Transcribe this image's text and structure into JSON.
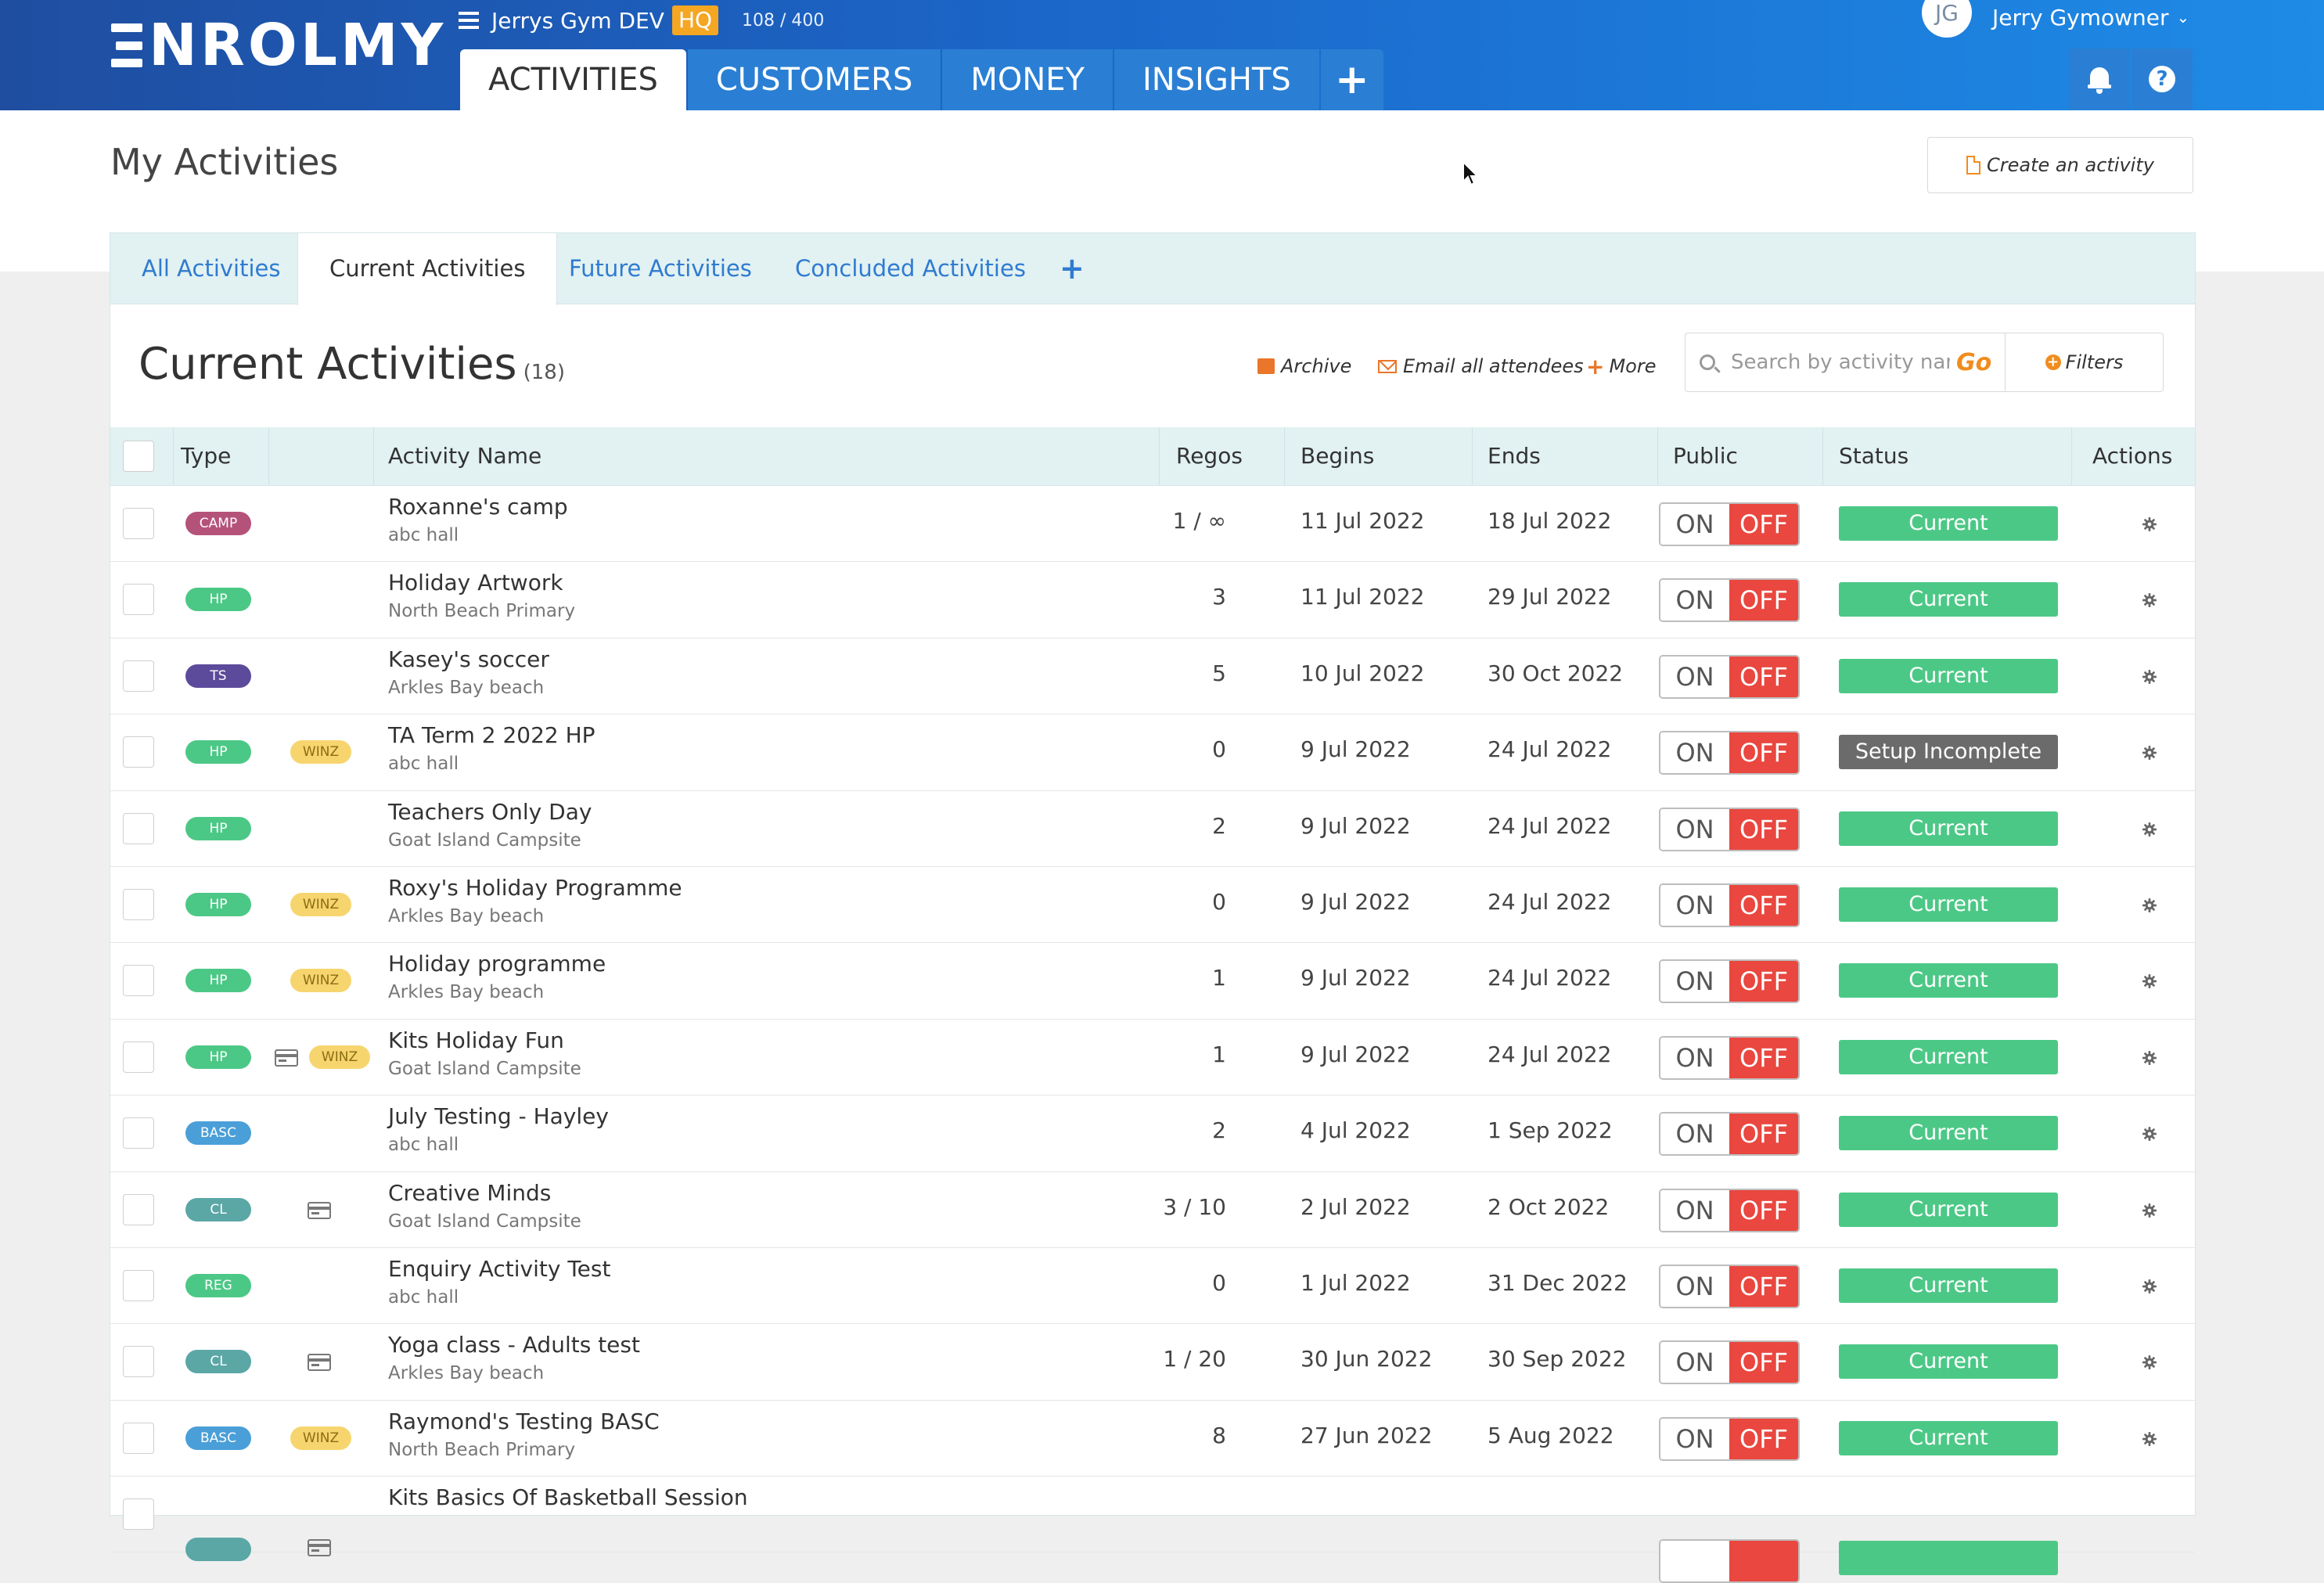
{
  "header": {
    "logo": "NROLMY",
    "account_name": "Jerrys Gym DEV",
    "account_badge": "HQ",
    "usage": "108 / 400",
    "nav": [
      {
        "label": "ACTIVITIES",
        "active": true
      },
      {
        "label": "CUSTOMERS",
        "active": false
      },
      {
        "label": "MONEY",
        "active": false
      },
      {
        "label": "INSIGHTS",
        "active": false
      }
    ],
    "nav_add": "+",
    "user_initials": "JG",
    "user_name": "Jerry Gymowner",
    "user_caret": "⌄",
    "help": "?"
  },
  "page": {
    "title": "My Activities",
    "create_label": "Create an activity"
  },
  "subtabs": [
    {
      "label": "All Activities",
      "active": false
    },
    {
      "label": "Current Activities",
      "active": true
    },
    {
      "label": "Future Activities",
      "active": false
    },
    {
      "label": "Concluded Activities",
      "active": false
    }
  ],
  "subtab_add": "+",
  "list": {
    "title": "Current Activities",
    "count": "(18)",
    "archive": "Archive",
    "email_all": "Email all attendees",
    "more_plus": "+",
    "more": "More",
    "search_placeholder": "Search by activity name",
    "go": "Go",
    "filters": "Filters"
  },
  "table": {
    "columns": {
      "type": "Type",
      "name": "Activity Name",
      "regos": "Regos",
      "begins": "Begins",
      "ends": "Ends",
      "public": "Public",
      "status": "Status",
      "actions": "Actions"
    },
    "toggle_on": "ON",
    "toggle_off": "OFF",
    "rows": [
      {
        "type": "CAMP",
        "type_color": "#b5527a",
        "card": false,
        "winz": "",
        "name": "Roxanne's camp",
        "location": "abc hall",
        "regos": "1 / ∞",
        "begins": "11 Jul 2022",
        "ends": "18 Jul 2022",
        "status": "Current",
        "status_color": "#4cc886"
      },
      {
        "type": "HP",
        "type_color": "#4cc886",
        "card": false,
        "winz": "",
        "name": "Holiday Artwork",
        "location": "North Beach Primary",
        "regos": "3",
        "begins": "11 Jul 2022",
        "ends": "29 Jul 2022",
        "status": "Current",
        "status_color": "#4cc886"
      },
      {
        "type": "TS",
        "type_color": "#5c4a9a",
        "card": false,
        "winz": "",
        "name": "Kasey's soccer",
        "location": "Arkles Bay beach",
        "regos": "5",
        "begins": "10 Jul 2022",
        "ends": "30 Oct 2022",
        "status": "Current",
        "status_color": "#4cc886"
      },
      {
        "type": "HP",
        "type_color": "#4cc886",
        "card": false,
        "winz": "WINZ",
        "name": "TA Term 2 2022 HP",
        "location": "abc hall",
        "regos": "0",
        "begins": "9 Jul 2022",
        "ends": "24 Jul 2022",
        "status": "Setup Incomplete",
        "status_color": "#6b6b6b"
      },
      {
        "type": "HP",
        "type_color": "#4cc886",
        "card": false,
        "winz": "",
        "name": "Teachers Only Day",
        "location": "Goat Island Campsite",
        "regos": "2",
        "begins": "9 Jul 2022",
        "ends": "24 Jul 2022",
        "status": "Current",
        "status_color": "#4cc886"
      },
      {
        "type": "HP",
        "type_color": "#4cc886",
        "card": false,
        "winz": "WINZ",
        "name": "Roxy's Holiday Programme",
        "location": "Arkles Bay beach",
        "regos": "0",
        "begins": "9 Jul 2022",
        "ends": "24 Jul 2022",
        "status": "Current",
        "status_color": "#4cc886"
      },
      {
        "type": "HP",
        "type_color": "#4cc886",
        "card": false,
        "winz": "WINZ",
        "name": "Holiday programme",
        "location": "Arkles Bay beach",
        "regos": "1",
        "begins": "9 Jul 2022",
        "ends": "24 Jul 2022",
        "status": "Current",
        "status_color": "#4cc886"
      },
      {
        "type": "HP",
        "type_color": "#4cc886",
        "card": true,
        "winz": "WINZ",
        "name": "Kits Holiday Fun",
        "location": "Goat Island Campsite",
        "regos": "1",
        "begins": "9 Jul 2022",
        "ends": "24 Jul 2022",
        "status": "Current",
        "status_color": "#4cc886"
      },
      {
        "type": "BASC",
        "type_color": "#4a9fd8",
        "card": false,
        "winz": "",
        "name": "July Testing - Hayley",
        "location": "abc hall",
        "regos": "2",
        "begins": "4 Jul 2022",
        "ends": "1 Sep 2022",
        "status": "Current",
        "status_color": "#4cc886"
      },
      {
        "type": "CL",
        "type_color": "#5aa7a6",
        "card": true,
        "winz": "",
        "name": "Creative Minds",
        "location": "Goat Island Campsite",
        "regos": "3 / 10",
        "begins": "2 Jul 2022",
        "ends": "2 Oct 2022",
        "status": "Current",
        "status_color": "#4cc886"
      },
      {
        "type": "REG",
        "type_color": "#4cc886",
        "card": false,
        "winz": "",
        "name": "Enquiry Activity Test",
        "location": "abc hall",
        "regos": "0",
        "begins": "1 Jul 2022",
        "ends": "31 Dec 2022",
        "status": "Current",
        "status_color": "#4cc886"
      },
      {
        "type": "CL",
        "type_color": "#5aa7a6",
        "card": true,
        "winz": "",
        "name": "Yoga class - Adults test",
        "location": "Arkles Bay beach",
        "regos": "1 / 20",
        "begins": "30 Jun 2022",
        "ends": "30 Sep 2022",
        "status": "Current",
        "status_color": "#4cc886"
      },
      {
        "type": "BASC",
        "type_color": "#4a9fd8",
        "card": false,
        "winz": "WINZ",
        "name": "Raymond's Testing BASC",
        "location": "North Beach Primary",
        "regos": "8",
        "begins": "27 Jun 2022",
        "ends": "5 Aug 2022",
        "status": "Current",
        "status_color": "#4cc886"
      },
      {
        "type": "",
        "type_color": "#5aa7a6",
        "card": true,
        "winz": "",
        "name": "Kits Basics Of Basketball Session",
        "location": "",
        "regos": "",
        "begins": "",
        "ends": "",
        "status": "",
        "status_color": "#4cc886"
      }
    ]
  }
}
